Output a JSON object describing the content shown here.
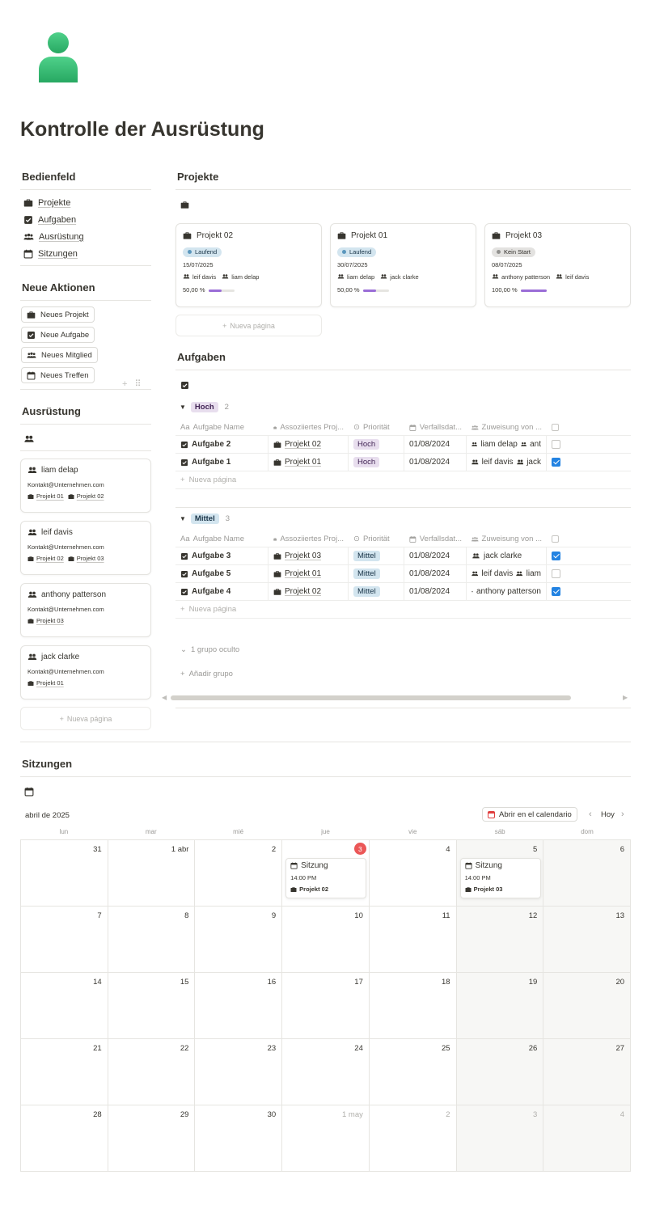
{
  "page": {
    "title": "Kontrolle der Ausrüstung"
  },
  "colors": {
    "accent": "#2383e2",
    "purple_bar": "#9a6dd7",
    "today": "#eb5757",
    "avatar_green": "#3ec275"
  },
  "sidebar": {
    "panel_title": "Bedienfeld",
    "nav": [
      {
        "label": "Projekte",
        "icon": "briefcase-icon"
      },
      {
        "label": "Aufgaben",
        "icon": "checkbox-icon"
      },
      {
        "label": "Ausrüstung",
        "icon": "people-icon"
      },
      {
        "label": "Sitzungen",
        "icon": "calendar-icon"
      }
    ],
    "actions_title": "Neue Aktionen",
    "actions": [
      {
        "label": "Neues Projekt",
        "icon": "briefcase-icon"
      },
      {
        "label": "Neue Aufgabe",
        "icon": "checkbox-icon"
      },
      {
        "label": "Neues Mitglied",
        "icon": "people-icon"
      },
      {
        "label": "Neues Treffen",
        "icon": "calendar-icon"
      }
    ],
    "equipment_title": "Ausrüstung",
    "members": [
      {
        "name": "liam delap",
        "email": "Kontakt@Unternehmen.com",
        "projects": [
          "Projekt 01",
          "Projekt 02"
        ]
      },
      {
        "name": "leif davis",
        "email": "Kontakt@Unternehmen.com",
        "projects": [
          "Projekt 02",
          "Projekt 03"
        ]
      },
      {
        "name": "anthony patterson",
        "email": "Kontakt@Unternehmen.com",
        "projects": [
          "Projekt 03"
        ]
      },
      {
        "name": "jack clarke",
        "email": "Kontakt@Unternehmen.com",
        "projects": [
          "Projekt 01"
        ]
      }
    ],
    "new_page": "Nueva página"
  },
  "projects": {
    "title": "Projekte",
    "cards": [
      {
        "name": "Projekt 02",
        "status": "Laufend",
        "date": "15/07/2025",
        "people": [
          "leif davis",
          "liam delap"
        ],
        "percent_label": "50,00 %",
        "progress": 0.5
      },
      {
        "name": "Projekt 01",
        "status": "Laufend",
        "date": "30/07/2025",
        "people": [
          "liam delap",
          "jack clarke"
        ],
        "percent_label": "50,00 %",
        "progress": 0.5
      },
      {
        "name": "Projekt 03",
        "status": "Kein Start",
        "date": "08/07/2025",
        "people": [
          "anthony patterson",
          "leif davis"
        ],
        "percent_label": "100,00 %",
        "progress": 1.0
      }
    ],
    "new_page": "Nueva página"
  },
  "tasks": {
    "title": "Aufgaben",
    "columns": [
      "Aufgabe Name",
      "Assoziiertes Proj...",
      "Priorität",
      "Verfallsdat...",
      "Zuweisung von ..."
    ],
    "groups": [
      {
        "label": "Hoch",
        "count": "2",
        "rows": [
          {
            "name": "Aufgabe 2",
            "project": "Projekt 02",
            "priority": "Hoch",
            "due": "01/08/2024",
            "people": [
              "liam delap",
              "ant"
            ],
            "done": false
          },
          {
            "name": "Aufgabe 1",
            "project": "Projekt 01",
            "priority": "Hoch",
            "due": "01/08/2024",
            "people": [
              "leif davis",
              "jack"
            ],
            "done": true
          }
        ]
      },
      {
        "label": "Mittel",
        "count": "3",
        "rows": [
          {
            "name": "Aufgabe 3",
            "project": "Projekt 03",
            "priority": "Mittel",
            "due": "01/08/2024",
            "people": [
              "jack clarke"
            ],
            "done": true
          },
          {
            "name": "Aufgabe 5",
            "project": "Projekt 01",
            "priority": "Mittel",
            "due": "01/08/2024",
            "people": [
              "leif davis",
              "liam"
            ],
            "done": false
          },
          {
            "name": "Aufgabe 4",
            "project": "Projekt 02",
            "priority": "Mittel",
            "due": "01/08/2024",
            "people": [
              "anthony patterson"
            ],
            "done": true
          }
        ]
      }
    ],
    "new_page": "Nueva página",
    "hidden_groups": "1 grupo oculto",
    "add_group": "Añadir grupo"
  },
  "meetings": {
    "title": "Sitzungen",
    "month": "abril de 2025",
    "open_calendar": "Abrir en el calendario",
    "today_btn": "Hoy",
    "weekdays": [
      "lun",
      "mar",
      "mié",
      "jue",
      "vie",
      "sáb",
      "dom"
    ],
    "weeks": [
      [
        "31",
        "1 abr",
        "2",
        "3",
        "4",
        "5",
        "6"
      ],
      [
        "7",
        "8",
        "9",
        "10",
        "11",
        "12",
        "13"
      ],
      [
        "14",
        "15",
        "16",
        "17",
        "18",
        "19",
        "20"
      ],
      [
        "21",
        "22",
        "23",
        "24",
        "25",
        "26",
        "27"
      ],
      [
        "28",
        "29",
        "30",
        "1 may",
        "2",
        "3",
        "4"
      ]
    ],
    "events": [
      {
        "title": "Sitzung",
        "time": "14:00 PM",
        "project": "Projekt 02"
      },
      {
        "title": "Sitzung",
        "time": "14:00 PM",
        "project": "Projekt 03"
      }
    ]
  }
}
